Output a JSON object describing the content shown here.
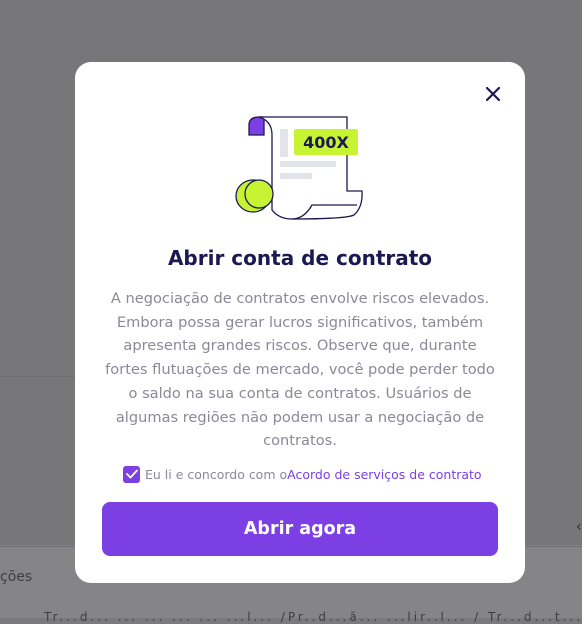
{
  "background": {
    "section_label": "ções",
    "footer_text": "Tr...d... ... ... ... ... ...l... /Pr..d...ã...     ...lir..l... / Tr...d...t...",
    "chevron": "‹"
  },
  "modal": {
    "close_icon": "close-icon",
    "badge": "400X",
    "title": "Abrir conta de contrato",
    "description": "A negociação de contratos envolve riscos elevados. Embora possa gerar lucros significativos, também apresenta grandes riscos. Observe que, durante fortes flutuações de mercado, você pode perder todo o saldo na sua conta de contratos. Usuários de algumas regiões não podem usar a negociação de contratos.",
    "agreement": {
      "checked": true,
      "text": "Eu li e concordo com o",
      "link": "Acordo de serviços de contrato"
    },
    "cta_label": "Abrir agora"
  },
  "colors": {
    "accent": "#7b3fe4",
    "lime": "#c6f432",
    "title": "#1c1850",
    "text_muted": "#8a8a96"
  }
}
